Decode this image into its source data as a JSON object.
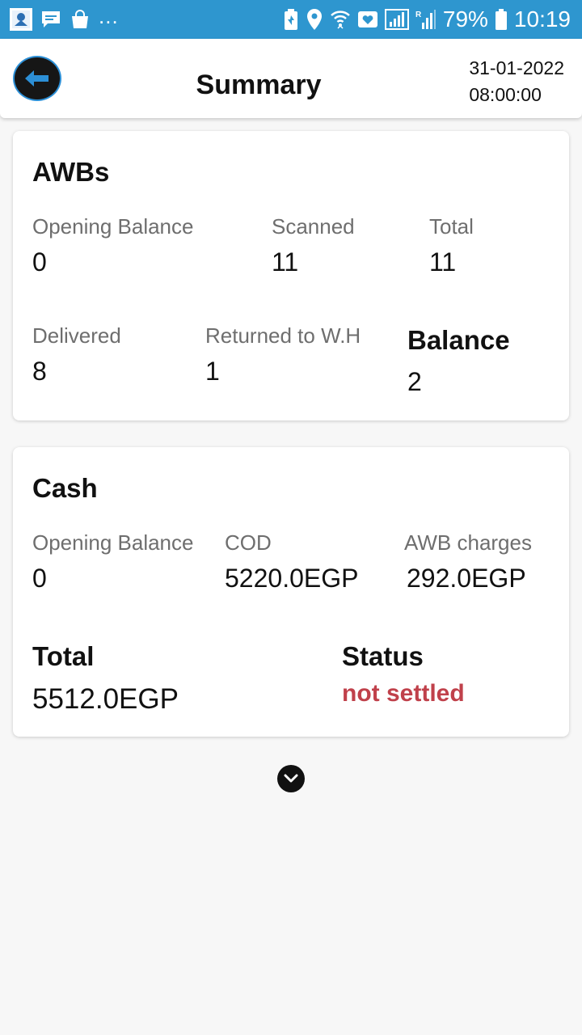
{
  "status_bar": {
    "battery_percent": "79%",
    "time": "10:19",
    "overflow": "...",
    "left_icons": [
      "app-logo-icon",
      "message-icon",
      "shopping-bag-icon"
    ],
    "right_icons": [
      "battery-saver-icon",
      "location-icon",
      "wifi-icon",
      "heart-box-icon",
      "signal-icon",
      "roaming-signal-icon",
      "battery-icon"
    ]
  },
  "header": {
    "title": "Summary",
    "date": "31-01-2022",
    "time": "08:00:00",
    "back_icon": "arrow-left-icon"
  },
  "awbs": {
    "title": "AWBs",
    "opening_balance_label": "Opening Balance",
    "opening_balance_value": "0",
    "scanned_label": "Scanned",
    "scanned_value": "11",
    "total_label": "Total",
    "total_value": "11",
    "delivered_label": "Delivered",
    "delivered_value": "8",
    "returned_label": "Returned to W.H",
    "returned_value": "1",
    "balance_label": "Balance",
    "balance_value": "2"
  },
  "cash": {
    "title": "Cash",
    "opening_balance_label": "Opening Balance",
    "opening_balance_value": "0",
    "cod_label": "COD",
    "cod_value": "5220.0EGP",
    "awb_charges_label": "AWB charges",
    "awb_charges_value": "292.0EGP",
    "total_label": "Total",
    "total_value": "5512.0EGP",
    "status_label": "Status",
    "status_value": "not settled"
  },
  "colors": {
    "status_bar": "#2e96cf",
    "back_button_border": "#2c8fd6",
    "status_not_settled": "#c0414b"
  },
  "expand_icon": "chevron-down-icon"
}
